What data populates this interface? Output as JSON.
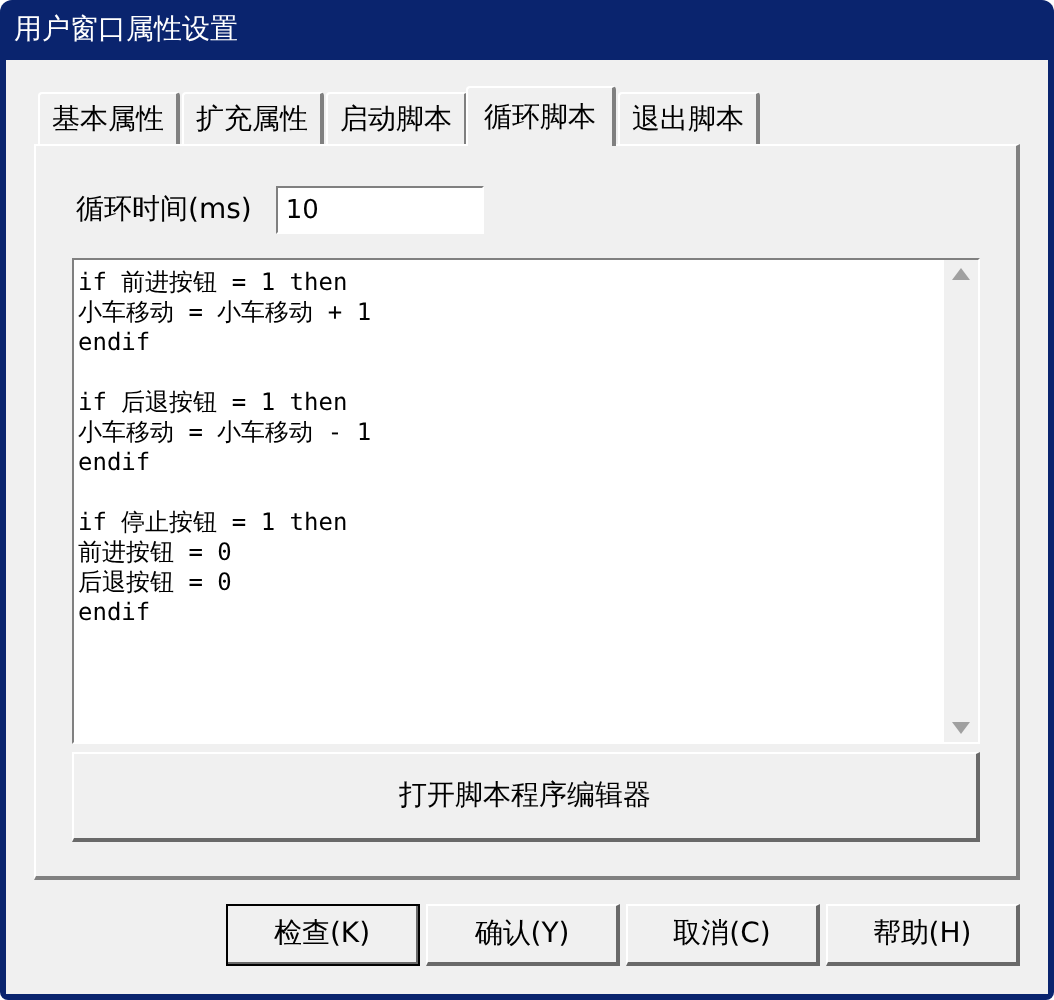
{
  "window": {
    "title": "用户窗口属性设置"
  },
  "tabs": [
    {
      "label": "基本属性",
      "selected": false
    },
    {
      "label": "扩充属性",
      "selected": false
    },
    {
      "label": "启动脚本",
      "selected": false
    },
    {
      "label": "循环脚本",
      "selected": true
    },
    {
      "label": "退出脚本",
      "selected": false
    }
  ],
  "cycle_time": {
    "label": "循环时间(ms)",
    "value": "10"
  },
  "script": {
    "text": "if 前进按钮 = 1 then\n小车移动 = 小车移动 + 1\nendif\n\nif 后退按钮 = 1 then\n小车移动 = 小车移动 - 1\nendif\n\nif 停止按钮 = 1 then\n前进按钮 = 0\n后退按钮 = 0\nendif"
  },
  "editor_button": {
    "label": "打开脚本程序编辑器"
  },
  "buttons": [
    {
      "label": "检查(K)",
      "selected": true
    },
    {
      "label": "确认(Y)",
      "selected": false
    },
    {
      "label": "取消(C)",
      "selected": false
    },
    {
      "label": "帮助(H)",
      "selected": false
    }
  ]
}
